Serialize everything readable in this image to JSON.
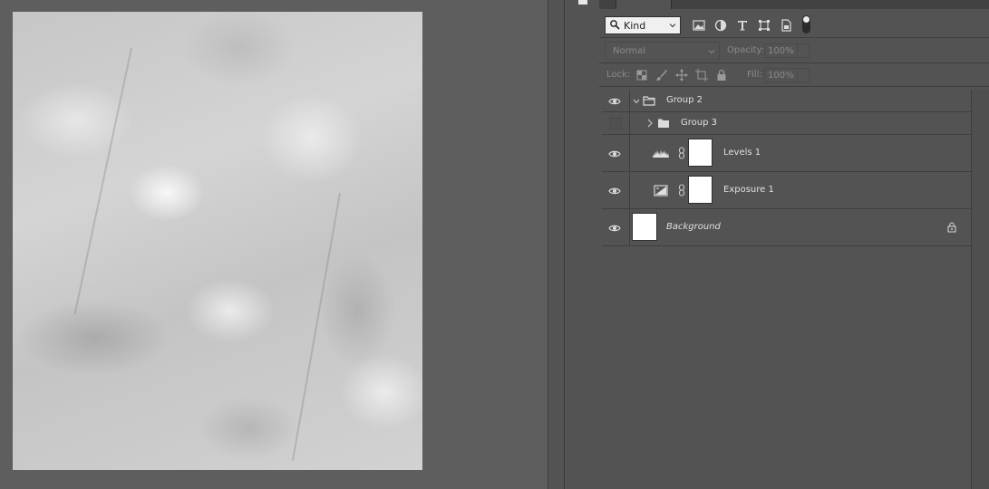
{
  "canvas": {
    "document_description": "Grayscale blurred texture image"
  },
  "layers_panel": {
    "filter": {
      "kind_label": "Kind",
      "icons": [
        "pixel-filter-icon",
        "adjustment-filter-icon",
        "type-filter-icon",
        "shape-filter-icon",
        "smart-object-filter-icon"
      ]
    },
    "blend": {
      "mode": "Normal",
      "opacity_label": "Opacity:",
      "opacity_value": "100%"
    },
    "lock": {
      "label": "Lock:",
      "fill_label": "Fill:",
      "fill_value": "100%"
    },
    "layers": [
      {
        "name": "Group 2",
        "type": "group",
        "visible": true,
        "expanded": true
      },
      {
        "name": "Group 3",
        "type": "group",
        "visible": false,
        "expanded": false
      },
      {
        "name": "Levels 1",
        "type": "adjustment-levels",
        "visible": true
      },
      {
        "name": "Exposure 1",
        "type": "adjustment-exposure",
        "visible": true
      },
      {
        "name": "Background",
        "type": "background",
        "visible": true,
        "locked": true
      }
    ]
  },
  "colors": {
    "panel_bg": "#535353",
    "canvas_bg": "#5e5e5e",
    "text": "#e0e0e0"
  }
}
